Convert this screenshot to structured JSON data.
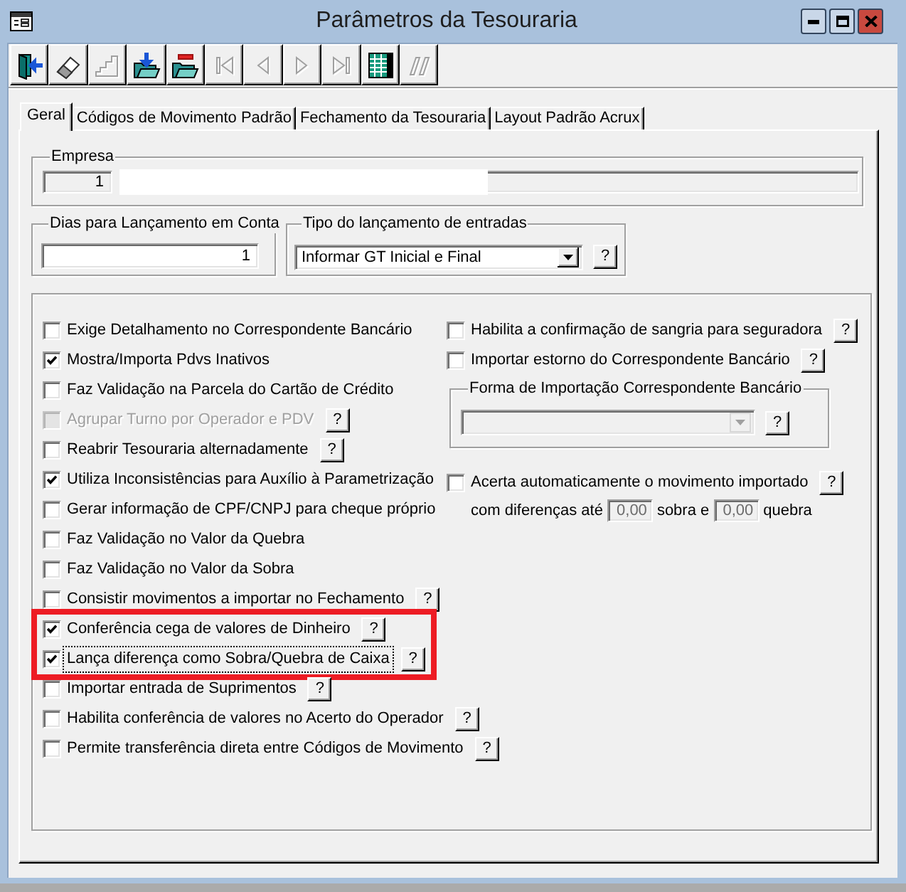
{
  "window": {
    "title": "Parâmetros da Tesouraria"
  },
  "toolbar": [
    {
      "kind": "exit",
      "disabled": false
    },
    {
      "kind": "eraser",
      "disabled": false
    },
    {
      "kind": "steps",
      "disabled": true
    },
    {
      "kind": "download",
      "disabled": false
    },
    {
      "kind": "remove",
      "disabled": false
    },
    {
      "kind": "first",
      "disabled": true
    },
    {
      "kind": "previous",
      "disabled": true
    },
    {
      "kind": "next",
      "disabled": true
    },
    {
      "kind": "last",
      "disabled": true
    },
    {
      "kind": "grid",
      "disabled": false
    },
    {
      "kind": "bars",
      "disabled": true
    }
  ],
  "tabs": [
    {
      "label": "Geral",
      "selected": true
    },
    {
      "label": "Códigos de Movimento Padrão",
      "selected": false
    },
    {
      "label": "Fechamento da Tesouraria",
      "selected": false
    },
    {
      "label": "Layout Padrão Acrux",
      "selected": false
    }
  ],
  "empresa": {
    "label": "Empresa",
    "code": "1",
    "code_readonly": true
  },
  "dias": {
    "label": "Dias para Lançamento em Conta",
    "value": "1"
  },
  "tipo": {
    "label": "Tipo do lançamento de entradas",
    "value": "Informar GT Inicial e Final",
    "help": "?"
  },
  "left_options": [
    {
      "label": "Exige Detalhamento no Correspondente Bancário",
      "checked": false,
      "disabled": false,
      "focused": false,
      "highlighted": false
    },
    {
      "label": "Mostra/Importa Pdvs Inativos",
      "checked": true,
      "disabled": false,
      "focused": false,
      "highlighted": false
    },
    {
      "label": "Faz Validação na Parcela do Cartão de Crédito",
      "checked": false,
      "disabled": false,
      "focused": false,
      "highlighted": false
    },
    {
      "label": "Agrupar Turno por Operador e PDV",
      "checked": false,
      "disabled": true,
      "focused": false,
      "highlighted": false,
      "help": "?"
    },
    {
      "label": "Reabrir Tesouraria alternadamente",
      "checked": false,
      "disabled": false,
      "focused": false,
      "highlighted": false,
      "help": "?"
    },
    {
      "label": "Utiliza Inconsistências para Auxílio à Parametrização",
      "checked": true,
      "disabled": false,
      "focused": false,
      "highlighted": false
    },
    {
      "label": "Gerar informação de CPF/CNPJ para cheque próprio",
      "checked": false,
      "disabled": false,
      "focused": false,
      "highlighted": false
    },
    {
      "label": "Faz Validação no Valor da Quebra",
      "checked": false,
      "disabled": false,
      "focused": false,
      "highlighted": false
    },
    {
      "label": "Faz Validação no Valor da Sobra",
      "checked": false,
      "disabled": false,
      "focused": false,
      "highlighted": false
    },
    {
      "label": "Consistir movimentos a importar no Fechamento",
      "checked": false,
      "disabled": false,
      "focused": false,
      "highlighted": false,
      "help": "?"
    },
    {
      "label": "Conferência cega de valores de Dinheiro",
      "checked": true,
      "disabled": false,
      "focused": false,
      "highlighted": true,
      "help": "?"
    },
    {
      "label": "Lança diferença como Sobra/Quebra de Caixa",
      "checked": true,
      "disabled": false,
      "focused": true,
      "highlighted": true,
      "help": "?"
    },
    {
      "label": "Importar entrada de Suprimentos",
      "checked": false,
      "disabled": false,
      "focused": false,
      "highlighted": false,
      "help": "?"
    },
    {
      "label": "Habilita conferência de valores no Acerto do Operador",
      "checked": false,
      "disabled": false,
      "focused": false,
      "highlighted": false,
      "help": "?"
    },
    {
      "label": "Permite transferência direta entre Códigos de Movimento",
      "checked": false,
      "disabled": false,
      "focused": false,
      "highlighted": false,
      "help": "?"
    }
  ],
  "right_options": [
    {
      "label": "Habilita a confirmação de sangria para seguradora",
      "checked": false,
      "help": "?"
    },
    {
      "label": "Importar estorno do Correspondente Bancário",
      "checked": false,
      "help": "?"
    }
  ],
  "forma": {
    "label": "Forma de Importação Correspondente Bancário",
    "disabled": true,
    "help": "?"
  },
  "acerta": {
    "label": "Acerta automaticamente o movimento importado",
    "checked": false,
    "help": "?",
    "line": [
      {
        "kind": "text",
        "text": "com diferenças até"
      },
      {
        "kind": "field",
        "value": "0,00",
        "disabled": true
      },
      {
        "kind": "text",
        "text": "sobra e"
      },
      {
        "kind": "field",
        "value": "0,00",
        "disabled": true
      },
      {
        "kind": "text",
        "text": "quebra"
      }
    ]
  }
}
